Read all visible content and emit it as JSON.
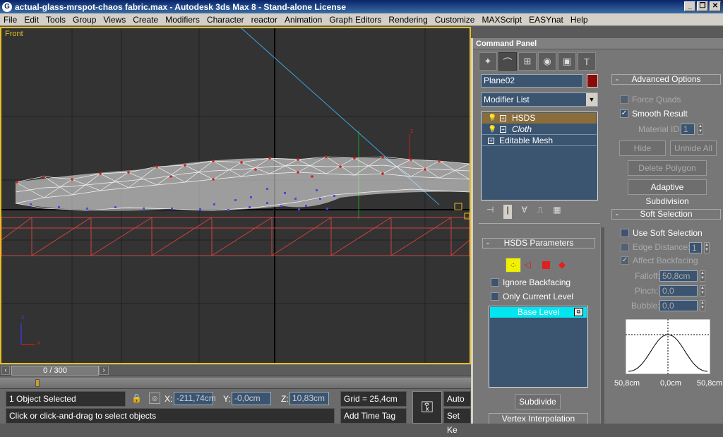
{
  "window": {
    "title": "actual-glass-mrspot-chaos fabric.max - Autodesk 3ds Max 8  - Stand-alone License"
  },
  "menu": [
    "File",
    "Edit",
    "Tools",
    "Group",
    "Views",
    "Create",
    "Modifiers",
    "Character",
    "reactor",
    "Animation",
    "Graph Editors",
    "Rendering",
    "Customize",
    "MAXScript",
    "EASYnat",
    "Help"
  ],
  "viewport": {
    "label": "Front",
    "axis_z": "z",
    "axis_x": "x"
  },
  "command_panel": {
    "title": "Command Panel",
    "object_name": "Plane02",
    "modifier_list_label": "Modifier List",
    "stack": [
      "HSDS",
      "Cloth",
      "Editable Mesh"
    ],
    "hsds": {
      "title": "HSDS Parameters",
      "ignore_backfacing": "Ignore Backfacing",
      "only_current_level": "Only Current Level",
      "base_level": "Base Level",
      "subdivide": "Subdivide",
      "vertex_interpolation": "Vertex Interpolation"
    },
    "advanced": {
      "title": "Advanced Options",
      "force_quads": "Force Quads",
      "smooth_result": "Smooth Result",
      "material_id_label": "Material ID",
      "material_id_value": "1",
      "hide": "Hide",
      "unhide_all": "Unhide All",
      "delete_polygon": "Delete Polygon",
      "adaptive_subdivision": "Adaptive Subdivision"
    },
    "soft_selection": {
      "title": "Soft Selection",
      "use_soft_selection": "Use Soft Selection",
      "edge_distance": "Edge Distance:",
      "edge_distance_value": "1",
      "affect_backfacing": "Affect Backfacing",
      "falloff_label": "Falloff:",
      "falloff_value": "50,8cm",
      "pinch_label": "Pinch:",
      "pinch_value": "0,0",
      "bubble_label": "Bubble:",
      "bubble_value": "0,0",
      "curve_left": "50,8cm",
      "curve_mid": "0,0cm",
      "curve_right": "50,8cm"
    }
  },
  "status": {
    "time_slider": "0 / 300",
    "selection": "1 Object Selected",
    "prompt": "Click or click-and-drag to select objects",
    "x_label": "X:",
    "x_value": "-211,74cm",
    "y_label": "Y:",
    "y_value": "-0,0cm",
    "z_label": "Z:",
    "z_value": "10,83cm",
    "grid": "Grid = 25,4cm",
    "add_time_tag": "Add Time Tag",
    "auto_key": "Auto Ke",
    "set_key": "Set Ke"
  }
}
